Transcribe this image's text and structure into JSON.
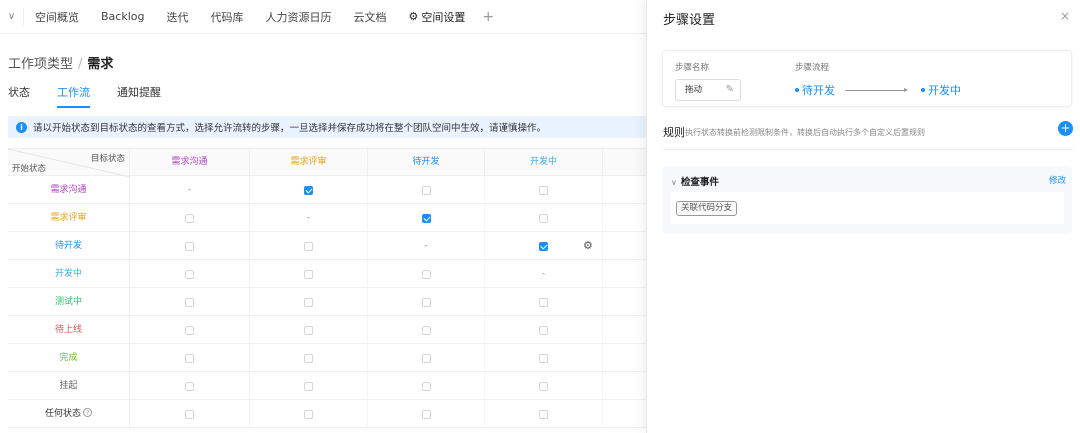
{
  "topnav": {
    "items": [
      "空间概览",
      "Backlog",
      "迭代",
      "代码库",
      "人力资源日历",
      "云文档",
      "空间设置"
    ],
    "plus": "+"
  },
  "breadcrumb": {
    "parent": "工作项类型",
    "sep": "/",
    "current": "需求"
  },
  "tabs": [
    "状态",
    "工作流",
    "通知提醒"
  ],
  "notice": "请以开始状态到目标状态的查看方式，选择允许流转的步骤，一旦选择并保存成功将在整个团队空间中生效，请谨慎操作。",
  "table": {
    "corner_target": "目标状态",
    "corner_source": "开始状态",
    "columns": [
      {
        "label": "需求沟通",
        "color": "#b044c2"
      },
      {
        "label": "需求评审",
        "color": "#e8a317"
      },
      {
        "label": "待开发",
        "color": "#1890ff"
      },
      {
        "label": "开发中",
        "color": "#43a9ec"
      }
    ],
    "rows": [
      {
        "label": "需求沟通",
        "color": "#b044c2",
        "cells": [
          "-",
          "on",
          "off",
          "off"
        ]
      },
      {
        "label": "需求评审",
        "color": "#e8a317",
        "cells": [
          "off",
          "-",
          "on",
          "off"
        ]
      },
      {
        "label": "待开发",
        "color": "#1890ff",
        "cells": [
          "off",
          "off",
          "-",
          "on"
        ]
      },
      {
        "label": "开发中",
        "color": "#43a9ec",
        "cells": [
          "off",
          "off",
          "off",
          "-"
        ]
      },
      {
        "label": "测试中",
        "color": "#2dc36a",
        "cells": [
          "off",
          "off",
          "off",
          "off"
        ]
      },
      {
        "label": "待上线",
        "color": "#ef4d4d",
        "cells": [
          "off",
          "off",
          "off",
          "off"
        ]
      },
      {
        "label": "完成",
        "color": "#6ab82c",
        "cells": [
          "off",
          "off",
          "off",
          "off"
        ]
      },
      {
        "label": "挂起",
        "color": "#666666",
        "cells": [
          "off",
          "off",
          "off",
          "off"
        ]
      },
      {
        "label": "任何状态",
        "color": "#333333",
        "cells": [
          "off",
          "off",
          "off",
          "off"
        ]
      }
    ]
  },
  "panel": {
    "title": "步骤设置",
    "close": "×",
    "step_name_label": "步骤名称",
    "step_name_value": "拖动",
    "step_flow_label": "步骤流程",
    "flow_from": "待开发",
    "flow_to": "开发中",
    "rules_title": "规则",
    "rules_desc": "执行状态转换前检测限制条件，转换后自动执行多个自定义后置规则",
    "add": "+",
    "event_title": "检查事件",
    "event_edit": "修改",
    "event_tag": "关联代码分支"
  }
}
